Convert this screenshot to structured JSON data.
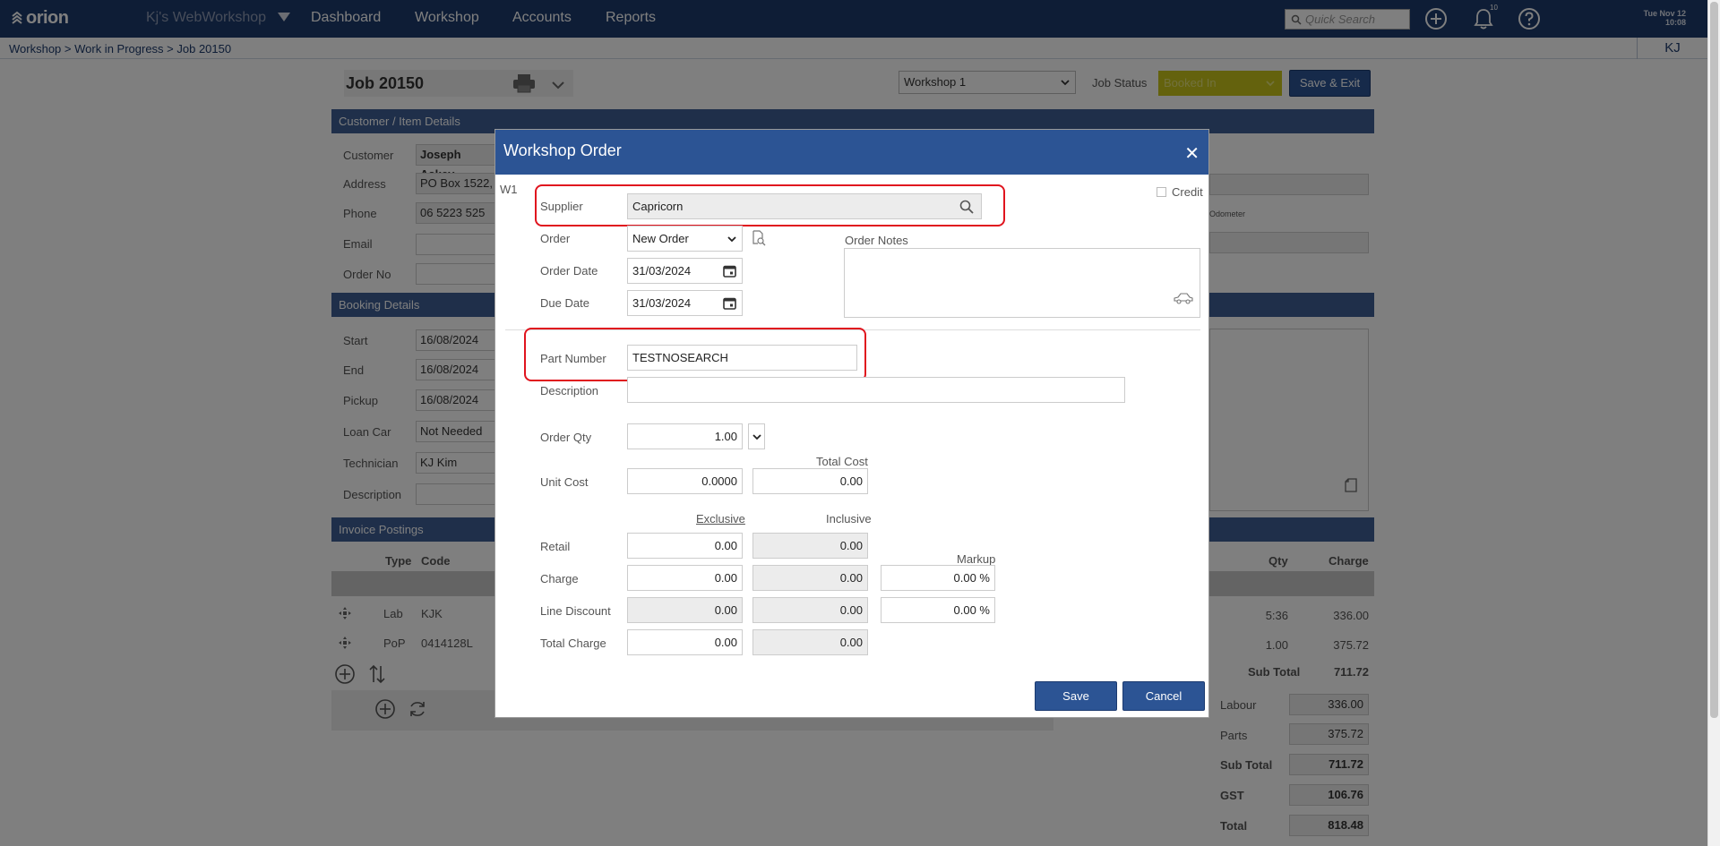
{
  "topbar": {
    "logo": "orion",
    "workshop_name": "Kj's WebWorkshop",
    "nav": [
      "Dashboard",
      "Workshop",
      "Accounts",
      "Reports"
    ],
    "search_placeholder": "Quick Search",
    "notification_count": "10",
    "date": "Tue Nov 12",
    "time": "10:08"
  },
  "breadcrumb": "Workshop > Work in Progress > Job 20150",
  "user_initials": "KJ",
  "job": {
    "title": "Job 20150",
    "workshop_select": "Workshop 1",
    "job_status_label": "Job Status",
    "job_status_value": "Booked In",
    "save_exit": "Save & Exit"
  },
  "customer_section": {
    "title": "Customer / Item Details",
    "fields": [
      {
        "label": "Customer",
        "value": "Joseph Askey"
      },
      {
        "label": "Address",
        "value": "PO Box 1522,"
      },
      {
        "label": "Phone",
        "value": "06 5223 525"
      },
      {
        "label": "Email",
        "value": ""
      },
      {
        "label": "Order No",
        "value": ""
      }
    ],
    "odometer_label": "Odometer"
  },
  "booking_section": {
    "title": "Booking Details",
    "fields": [
      {
        "label": "Start",
        "value": "16/08/2024"
      },
      {
        "label": "End",
        "value": "16/08/2024"
      },
      {
        "label": "Pickup",
        "value": "16/08/2024"
      },
      {
        "label": "Loan Car",
        "value": "Not Needed"
      },
      {
        "label": "Technician",
        "value": "KJ Kim"
      },
      {
        "label": "Description",
        "value": ""
      }
    ]
  },
  "invoice_section": {
    "title": "Invoice Postings",
    "headers": {
      "type": "Type",
      "code": "Code",
      "qty": "Qty",
      "charge": "Charge"
    },
    "rows": [
      {
        "type": "Lab",
        "code": "KJK",
        "qty": "5:36",
        "charge": "336.00"
      },
      {
        "type": "PoP",
        "code": "0414128L",
        "qty": "1.00",
        "charge": "375.72"
      }
    ],
    "subtotal_label": "Sub Total",
    "subtotal_value": "711.72"
  },
  "totals": [
    {
      "label": "Labour",
      "value": "336.00"
    },
    {
      "label": "Parts",
      "value": "375.72"
    },
    {
      "label": "Sub Total",
      "value": "711.72"
    },
    {
      "label": "GST",
      "value": "106.76"
    },
    {
      "label": "Total",
      "value": "818.48"
    }
  ],
  "modal": {
    "title": "Workshop Order",
    "code": "W1",
    "credit_label": "Credit",
    "supplier_label": "Supplier",
    "supplier_value": "Capricorn",
    "order_label": "Order",
    "order_value": "New Order",
    "order_date_label": "Order Date",
    "order_date_value": "31/03/2024",
    "due_date_label": "Due Date",
    "due_date_value": "31/03/2024",
    "order_notes_label": "Order Notes",
    "part_number_label": "Part Number",
    "part_number_value": "TESTNOSEARCH",
    "description_label": "Description",
    "description_value": "",
    "order_qty_label": "Order Qty",
    "order_qty_value": "1.00",
    "total_cost_label": "Total Cost",
    "unit_cost_label": "Unit Cost",
    "unit_cost_value": "0.0000",
    "total_cost_value": "0.00",
    "exclusive_label": "Exclusive",
    "inclusive_label": "Inclusive",
    "markup_label": "Markup",
    "retail_label": "Retail",
    "retail_excl": "0.00",
    "retail_incl": "0.00",
    "charge_label": "Charge",
    "charge_excl": "0.00",
    "charge_incl": "0.00",
    "charge_markup": "0.00 %",
    "line_discount_label": "Line Discount",
    "discount_excl": "0.00",
    "discount_incl": "0.00",
    "discount_markup": "0.00 %",
    "total_charge_label": "Total Charge",
    "total_charge_excl": "0.00",
    "total_charge_incl": "0.00",
    "save_label": "Save",
    "cancel_label": "Cancel"
  },
  "colors": {
    "navbar": "#1d3a6c",
    "section_bar": "#3e5f95",
    "modal_header": "#2c5494",
    "highlight_box": "#e0141e",
    "status_badge": "#c8c51a"
  }
}
